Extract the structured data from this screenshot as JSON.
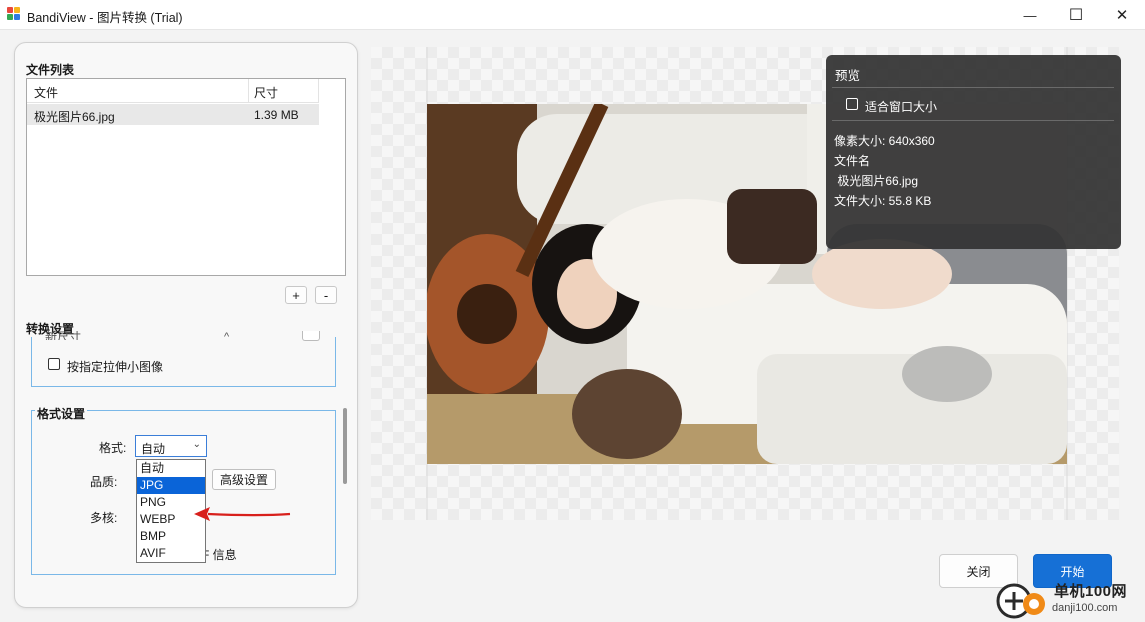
{
  "window": {
    "title": "BandiView - 图片转换 (Trial)",
    "minimize_glyph": "—",
    "maximize_glyph": "☐",
    "close_glyph": "✕"
  },
  "file_list": {
    "title": "文件列表",
    "columns": [
      "文件",
      "尺寸"
    ],
    "rows": [
      {
        "name": "极光图片66.jpg",
        "size": "1.39 MB"
      }
    ],
    "add_label": "+",
    "remove_label": "-"
  },
  "convert_settings": {
    "title": "转换设置",
    "partial_text": "新尺寸",
    "stretch_label": "按指定拉伸小图像"
  },
  "format_settings": {
    "title": "格式设置",
    "format_label": "格式:",
    "format_value": "自动",
    "quality_label": "品质:",
    "multicore_label": "多核:",
    "advanced_label": "高级设置",
    "partial_label": "F 信息",
    "options": [
      "自动",
      "JPG",
      "PNG",
      "WEBP",
      "BMP",
      "AVIF"
    ],
    "highlighted_option": "JPG"
  },
  "preview": {
    "title": "预览",
    "fit_window_label": "适合窗口大小",
    "pixel_size": "像素大小: 640x360",
    "file_name_label": "文件名",
    "file_name": " 极光图片66.jpg",
    "file_size": "文件大小: 55.8 KB"
  },
  "buttons": {
    "close": "关闭",
    "start": "开始"
  },
  "watermark": {
    "name": "单机100网",
    "url": "danji100.com"
  },
  "colors": {
    "accent": "#1670d6",
    "selected_option": "#0a64d8",
    "annotation_arrow": "#d8201c"
  }
}
